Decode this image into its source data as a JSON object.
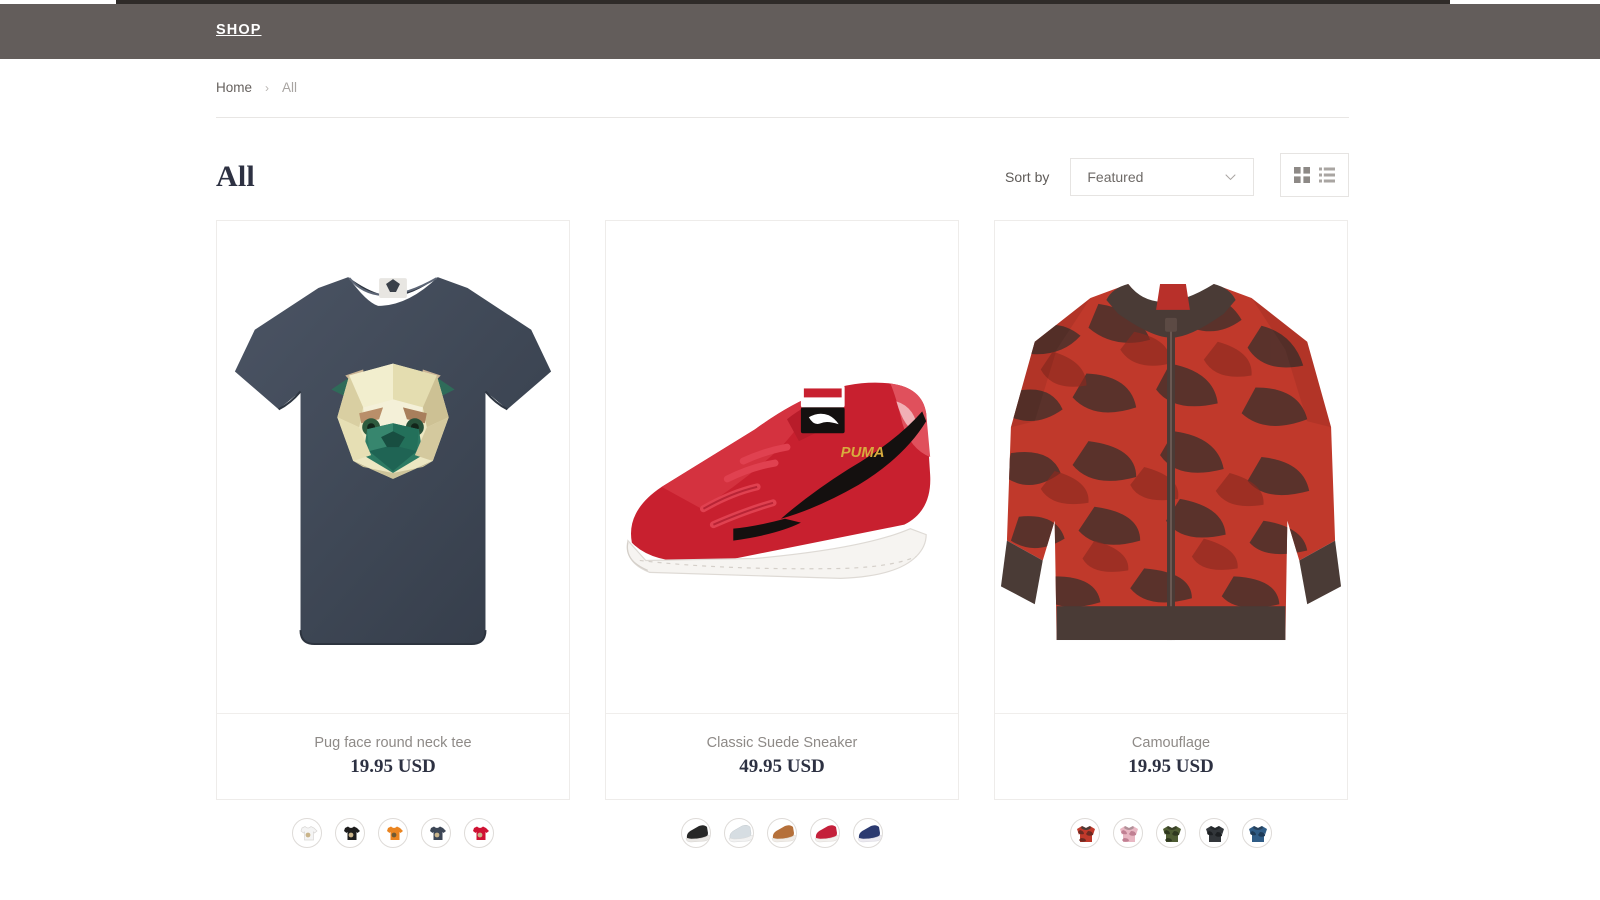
{
  "header": {
    "brand": "SHOP"
  },
  "breadcrumb": {
    "home_label": "Home",
    "separator": "›",
    "current_label": "All"
  },
  "toolbar": {
    "title": "All",
    "sort_label": "Sort by",
    "sort_value": "Featured",
    "sort_options": [
      "Featured"
    ],
    "chevron_icon": "chevron-down-icon",
    "grid_view_icon": "grid-view-icon",
    "list_view_icon": "list-view-icon"
  },
  "colors": {
    "header_bar": "#635d5b",
    "top_strip": "#2f2b29",
    "title_text": "#2d3142",
    "muted_text": "#8e8a87",
    "card_border": "#eeecea"
  },
  "products": [
    {
      "title": "Pug face round neck tee",
      "price": "19.95 USD",
      "image_name": "pug-face-tee-image",
      "swatches": [
        {
          "name": "swatch-tee-white",
          "shirt": "#f4f4f4",
          "accent": "#c9b48a",
          "outline": "#d8d6d4"
        },
        {
          "name": "swatch-tee-black",
          "shirt": "#1d1d1d",
          "accent": "#c9b48a",
          "outline": "#1d1d1d"
        },
        {
          "name": "swatch-tee-orange",
          "shirt": "#ea8420",
          "accent": "#6f5a33",
          "outline": "#ea8420"
        },
        {
          "name": "swatch-tee-navy",
          "shirt": "#3c4656",
          "accent": "#c9b48a",
          "outline": "#3c4656"
        },
        {
          "name": "swatch-tee-red",
          "shirt": "#cf1233",
          "accent": "#c9b48a",
          "outline": "#cf1233"
        }
      ]
    },
    {
      "title": "Classic Suede Sneaker",
      "price": "49.95 USD",
      "image_name": "classic-suede-sneaker-image",
      "swatches": [
        {
          "name": "swatch-sneaker-black",
          "shoe": "#272727",
          "sole": "#e9e7e4",
          "outline": "#272727"
        },
        {
          "name": "swatch-sneaker-white",
          "shoe": "#d6dde2",
          "sole": "#f2f2f2",
          "outline": "#c3cace"
        },
        {
          "name": "swatch-sneaker-tan",
          "shoe": "#b5703a",
          "sole": "#f0ece7",
          "outline": "#b5703a"
        },
        {
          "name": "swatch-sneaker-red",
          "shoe": "#c4203a",
          "sole": "#f2f0ed",
          "outline": "#c4203a"
        },
        {
          "name": "swatch-sneaker-navy",
          "shoe": "#2b3a70",
          "sole": "#eceaf0",
          "outline": "#2b3a70"
        }
      ]
    },
    {
      "title": "Camouflage",
      "price": "19.95 USD",
      "image_name": "camouflage-jacket-image",
      "swatches": [
        {
          "name": "swatch-jacket-red-camo",
          "base": "#c0392b",
          "blotch": "#6d2a22",
          "rib": "#4a3b36"
        },
        {
          "name": "swatch-jacket-pink-camo",
          "base": "#e8b6c2",
          "blotch": "#c07f92",
          "rib": "#b09098"
        },
        {
          "name": "swatch-jacket-green-camo",
          "base": "#4e5c33",
          "blotch": "#2f381f",
          "rib": "#3a4128"
        },
        {
          "name": "swatch-jacket-black",
          "base": "#32363a",
          "blotch": "#1c1f22",
          "rib": "#24282b"
        },
        {
          "name": "swatch-jacket-blue",
          "base": "#2f5c86",
          "blotch": "#1d3b58",
          "rib": "#27415b"
        }
      ]
    }
  ]
}
